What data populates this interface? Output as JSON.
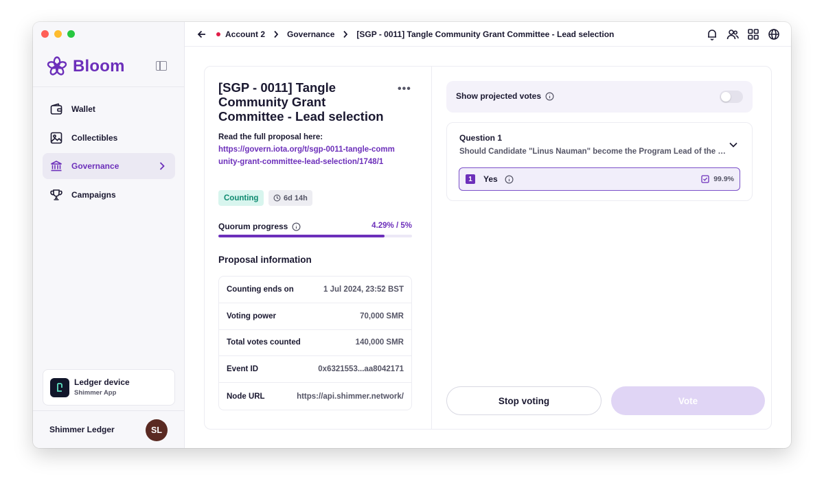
{
  "app": {
    "name": "Bloom"
  },
  "sidebar": {
    "items": [
      {
        "label": "Wallet",
        "icon": "wallet-icon"
      },
      {
        "label": "Collectibles",
        "icon": "image-icon"
      },
      {
        "label": "Governance",
        "icon": "bank-icon",
        "active": true
      },
      {
        "label": "Campaigns",
        "icon": "trophy-icon"
      }
    ],
    "ledger": {
      "title": "Ledger device",
      "subtitle": "Shimmer App"
    },
    "profile": {
      "name": "Shimmer Ledger",
      "initials": "SL"
    }
  },
  "topbar": {
    "breadcrumbs": [
      "Account 2",
      "Governance",
      "[SGP - 0011] Tangle Community Grant Committee - Lead selection"
    ]
  },
  "proposal": {
    "title": "[SGP - 0011] Tangle Community Grant Committee - Lead selection",
    "read_label": "Read the full proposal here:",
    "link": "https://govern.iota.org/t/sgp-0011-tangle-community-grant-committee-lead-selection/1748/1",
    "status": "Counting",
    "time_left": "6d 14h",
    "quorum_label": "Quorum progress",
    "quorum_value": "4.29% / 5%",
    "quorum_fraction": 0.858,
    "info_heading": "Proposal information",
    "info": [
      {
        "key": "Counting ends on",
        "value": "1 Jul 2024, 23:52 BST"
      },
      {
        "key": "Voting power",
        "value": "70,000 SMR"
      },
      {
        "key": "Total votes counted",
        "value": "140,000 SMR"
      },
      {
        "key": "Event ID",
        "value": "0x6321553...aa8042171"
      },
      {
        "key": "Node URL",
        "value": "https://api.shimmer.network/"
      }
    ]
  },
  "voting": {
    "projected_label": "Show projected votes",
    "question_title": "Question 1",
    "question_text": "Should Candidate \"Linus Nauman\" become the Program Lead of the Tangle Community Grant Committee?",
    "answer_number": "1",
    "answer_label": "Yes",
    "answer_percent": "99.9%",
    "stop_label": "Stop voting",
    "vote_label": "Vote"
  }
}
